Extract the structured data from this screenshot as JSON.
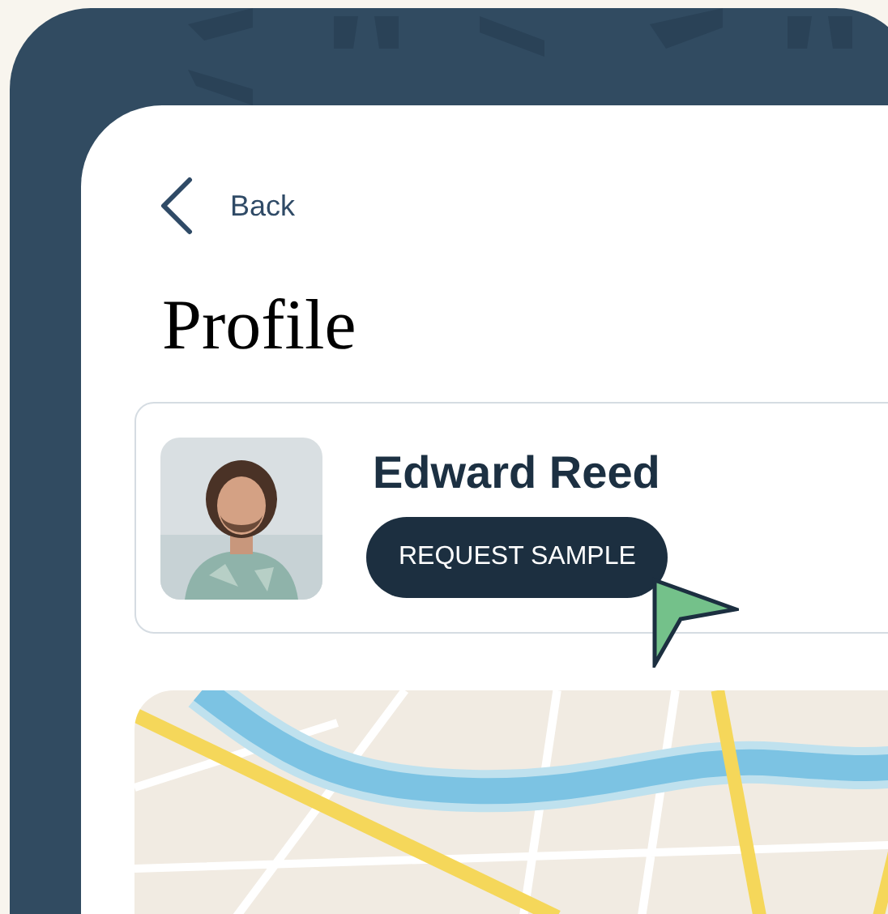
{
  "back": {
    "label": "Back"
  },
  "title": "Profile",
  "profile": {
    "name": "Edward Reed",
    "button": "REQUEST SAMPLE"
  }
}
